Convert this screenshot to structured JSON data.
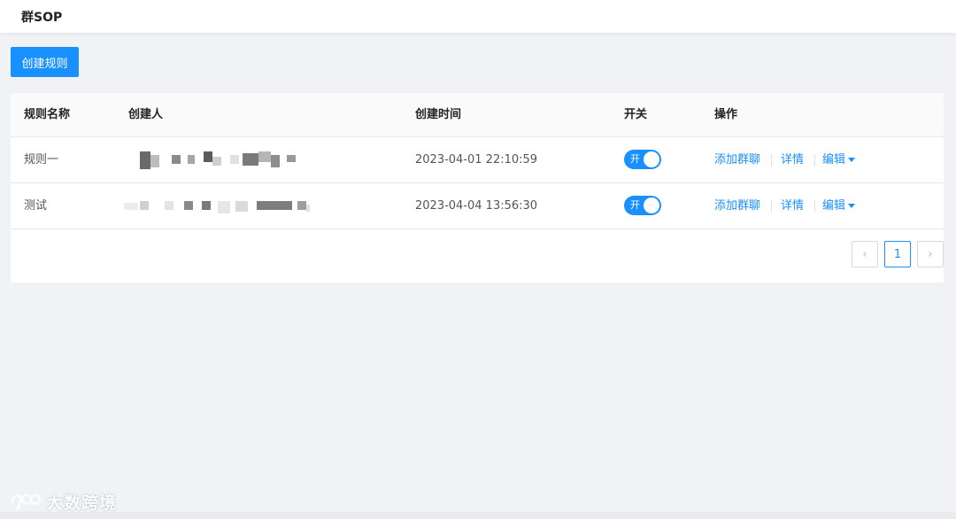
{
  "header": {
    "title": "群SOP"
  },
  "toolbar": {
    "create_label": "创建规则"
  },
  "table": {
    "columns": [
      "规则名称",
      "创建人",
      "创建时间",
      "开关",
      "操作"
    ],
    "rows": [
      {
        "name": "规则一",
        "created_at": "2023-04-01 22:10:59",
        "switch_label": "开"
      },
      {
        "name": "测试",
        "created_at": "2023-04-04 13:56:30",
        "switch_label": "开"
      }
    ],
    "actions": {
      "add_group": "添加群聊",
      "detail": "详情",
      "edit": "编辑"
    }
  },
  "pagination": {
    "prev": "‹",
    "current": "1",
    "next": "›"
  },
  "colors": {
    "primary": "#1890ff",
    "background": "#f0f2f5"
  },
  "watermark": {
    "text": "大数跨境"
  }
}
